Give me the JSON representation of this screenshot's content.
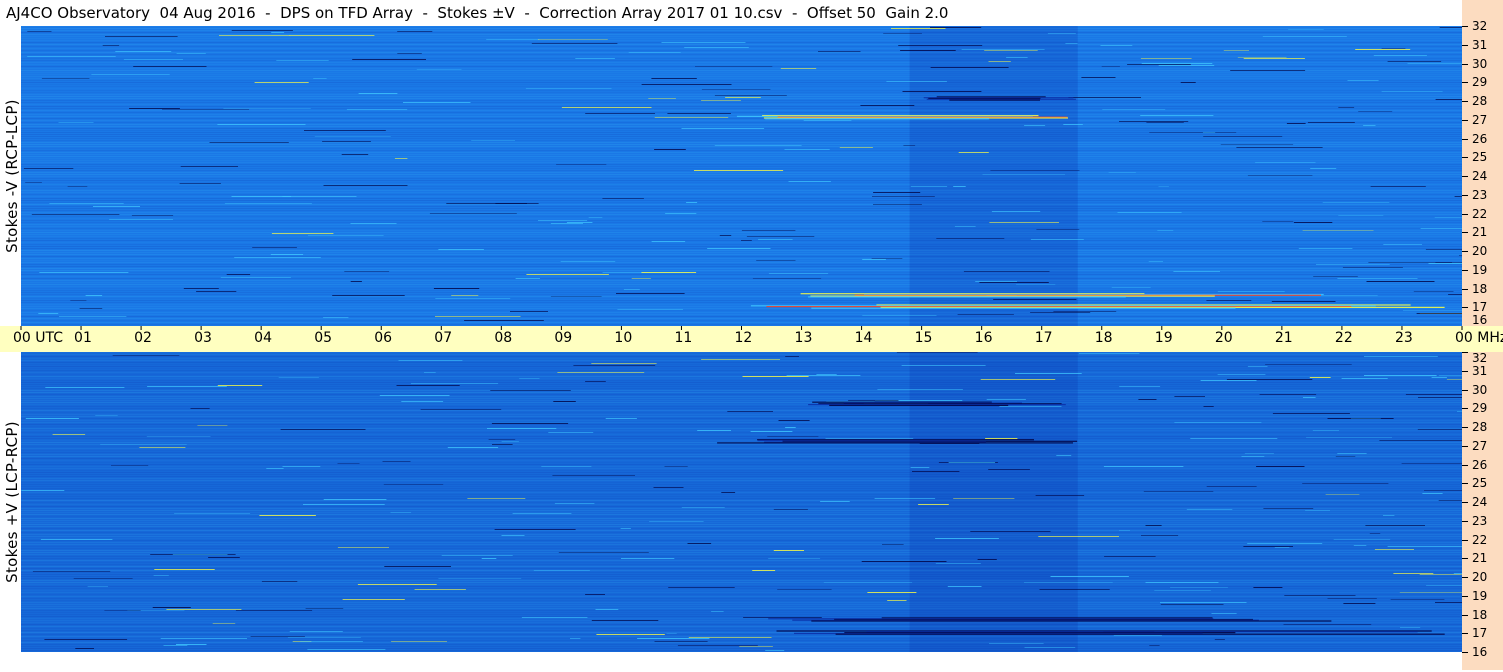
{
  "title": "AJ4CO Observatory  04 Aug 2016  -  DPS on TFD Array  -  Stokes ±V  -  Correction Array 2017 01 10.csv  -  Offset 50  Gain 2.0",
  "chart_data": [
    {
      "type": "heatmap",
      "ylabel": "Stokes -V (RCP-LCP)",
      "y_unit": "MHz",
      "ylim": [
        16,
        32
      ],
      "y_ticks": [
        "32",
        "31",
        "30",
        "29",
        "28",
        "27",
        "26",
        "25",
        "24",
        "23",
        "22",
        "21",
        "20",
        "19",
        "18",
        "17",
        "16"
      ],
      "x_unit": "UTC",
      "xlim": [
        0,
        24
      ],
      "colormap": [
        "#000040",
        "#0a2fa8",
        "#1a78e6",
        "#40c8ff",
        "#ffff40",
        "#ff4020"
      ],
      "background_color": "#1a78e6",
      "features": [
        {
          "freq_mhz": 27.2,
          "utc_start": 11.5,
          "utc_end": 18.2,
          "sign": "positive"
        },
        {
          "freq_mhz": 17.7,
          "utc_start": 12.5,
          "utc_end": 21.8,
          "sign": "positive"
        },
        {
          "freq_mhz": 17.1,
          "utc_start": 12.0,
          "utc_end": 24.0,
          "sign": "positive"
        },
        {
          "freq_mhz": 28.2,
          "utc_start": 15.0,
          "utc_end": 17.8,
          "sign": "negative"
        }
      ]
    },
    {
      "type": "heatmap",
      "ylabel": "Stokes +V (LCP-RCP)",
      "y_unit": "MHz",
      "ylim": [
        16,
        32
      ],
      "y_ticks": [
        "32",
        "31",
        "30",
        "29",
        "28",
        "27",
        "26",
        "25",
        "24",
        "23",
        "22",
        "21",
        "20",
        "19",
        "18",
        "17",
        "16"
      ],
      "x_unit": "UTC",
      "xlim": [
        0,
        24
      ],
      "colormap": [
        "#000040",
        "#0a2fa8",
        "#1668d8",
        "#40c8ff",
        "#ffff40",
        "#ff4020"
      ],
      "background_color": "#1668d8",
      "features": [
        {
          "freq_mhz": 27.3,
          "utc_start": 11.5,
          "utc_end": 17.8,
          "sign": "negative"
        },
        {
          "freq_mhz": 17.8,
          "utc_start": 12.3,
          "utc_end": 22.5,
          "sign": "negative"
        },
        {
          "freq_mhz": 17.1,
          "utc_start": 12.0,
          "utc_end": 24.0,
          "sign": "negative"
        },
        {
          "freq_mhz": 29.3,
          "utc_start": 13.0,
          "utc_end": 17.5,
          "sign": "negative"
        }
      ]
    }
  ],
  "time_axis": {
    "labels": [
      "00  UTC",
      "01",
      "02",
      "03",
      "04",
      "05",
      "06",
      "07",
      "08",
      "09",
      "10",
      "11",
      "12",
      "13",
      "14",
      "15",
      "16",
      "17",
      "18",
      "19",
      "20",
      "21",
      "22",
      "23",
      "00 MHz"
    ]
  },
  "colors": {
    "time_axis_bg": "#ffffc0",
    "freq_strip_bg": "#fcdcc0"
  }
}
